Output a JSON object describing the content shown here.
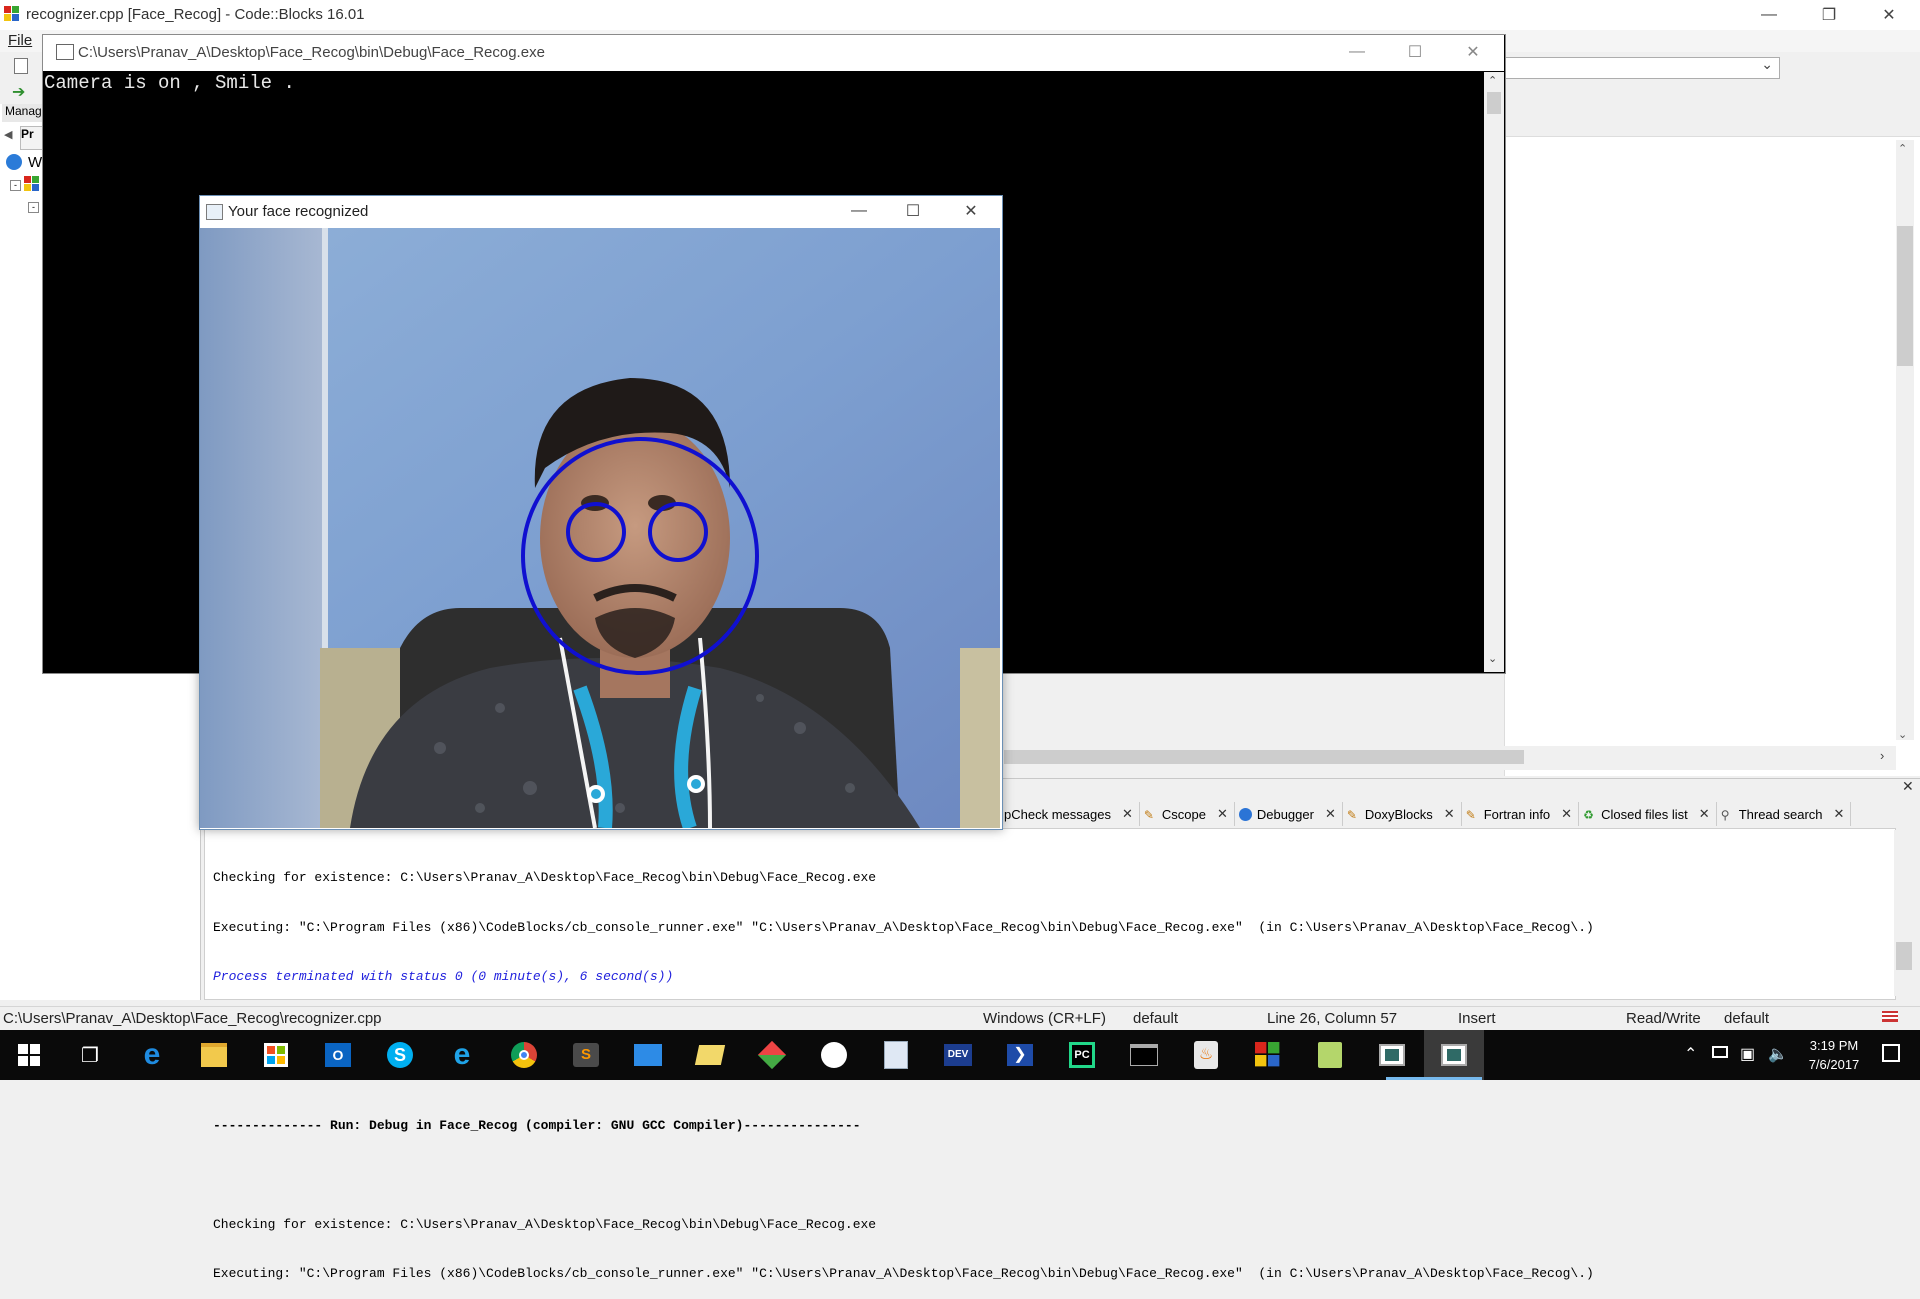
{
  "main_window": {
    "title": "recognizer.cpp [Face_Recog] - Code::Blocks 16.01",
    "menu_file": "File",
    "management_label": "Manag",
    "projects_tab": "Pr",
    "workspace_initial": "W"
  },
  "console_window": {
    "title": "C:\\Users\\Pranav_A\\Desktop\\Face_Recog\\bin\\Debug\\Face_Recog.exe",
    "output": "Camera is on , Smile ."
  },
  "face_window": {
    "title": "Your face recognized"
  },
  "log_tabs": [
    {
      "label": "pCheck messages",
      "icon": "none"
    },
    {
      "label": "Cscope",
      "icon": "pencil-icon"
    },
    {
      "label": "Debugger",
      "icon": "debugger-icon"
    },
    {
      "label": "DoxyBlocks",
      "icon": "pencil-icon"
    },
    {
      "label": "Fortran info",
      "icon": "pencil-icon"
    },
    {
      "label": "Closed files list",
      "icon": "recycle-icon"
    },
    {
      "label": "Thread search",
      "icon": "search-icon"
    }
  ],
  "build_log": [
    {
      "text": "Checking for existence: C:\\Users\\Pranav_A\\Desktop\\Face_Recog\\bin\\Debug\\Face_Recog.exe",
      "style": "normal"
    },
    {
      "text": "Executing: \"C:\\Program Files (x86)\\CodeBlocks/cb_console_runner.exe\" \"C:\\Users\\Pranav_A\\Desktop\\Face_Recog\\bin\\Debug\\Face_Recog.exe\"  (in C:\\Users\\Pranav_A\\Desktop\\Face_Recog\\.)",
      "style": "normal"
    },
    {
      "text": "Process terminated with status 0 (0 minute(s), 6 second(s))",
      "style": "italic"
    },
    {
      "text": " ",
      "style": "normal"
    },
    {
      "text": " ",
      "style": "normal"
    },
    {
      "text": "-------------- Run: Debug in Face_Recog (compiler: GNU GCC Compiler)---------------",
      "style": "bold"
    },
    {
      "text": " ",
      "style": "normal"
    },
    {
      "text": "Checking for existence: C:\\Users\\Pranav_A\\Desktop\\Face_Recog\\bin\\Debug\\Face_Recog.exe",
      "style": "normal"
    },
    {
      "text": "Executing: \"C:\\Program Files (x86)\\CodeBlocks/cb_console_runner.exe\" \"C:\\Users\\Pranav_A\\Desktop\\Face_Recog\\bin\\Debug\\Face_Recog.exe\"  (in C:\\Users\\Pranav_A\\Desktop\\Face_Recog\\.)",
      "style": "normal"
    }
  ],
  "statusbar": {
    "file_path": "C:\\Users\\Pranav_A\\Desktop\\Face_Recog\\recognizer.cpp",
    "line_endings": "Windows (CR+LF)",
    "encoding": "default",
    "position": "Line 26, Column 57",
    "mode": "Insert",
    "access": "Read/Write",
    "lang": "default"
  },
  "taskbar": {
    "time": "3:19 PM",
    "date": "7/6/2017",
    "apps": [
      "start-icon",
      "task-view-icon",
      "edge-icon",
      "file-explorer-icon",
      "store-icon",
      "outlook-icon",
      "skype-icon",
      "internet-explorer-icon",
      "chrome-icon",
      "sublime-text-icon",
      "app-icon",
      "folder-sync-icon",
      "git-icon",
      "github-icon",
      "notepad-icon",
      "dev-cpp-icon",
      "powershell-icon",
      "pycharm-icon",
      "command-prompt-icon",
      "java-icon",
      "codeblocks-icon",
      "notepad-plus-icon",
      "console-app-icon",
      "face-window-app-icon"
    ]
  },
  "colors": {
    "detection_circle": "#1010d0",
    "taskbar_bg": "#0a0a0a",
    "console_bg": "#000000"
  }
}
